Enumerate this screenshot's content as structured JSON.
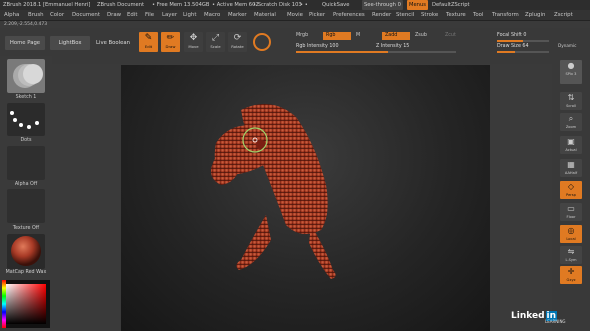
{
  "titlebar": {
    "app": "ZBrush 2018.1 [Emmanuel Henri]",
    "document": "ZBrush Document",
    "free_mem": "• Free Mem 13.504GB",
    "active_mem": "• Active Mem 602",
    "scratch": "• Scratch Disk 103",
    "dots": "• •",
    "quicksave": "QuickSave",
    "see_through": "See-through  0",
    "menus": "Menus",
    "script": "DefaultZScript"
  },
  "menu": [
    "Alpha",
    "Brush",
    "Color",
    "Document",
    "Draw",
    "Edit",
    "File",
    "Layer",
    "Light",
    "Macro",
    "Marker",
    "Material",
    "Movie",
    "Picker",
    "Preferences",
    "Render",
    "Stencil",
    "Stroke",
    "Texture",
    "Tool",
    "Transform",
    "Zplugin",
    "Zscript"
  ],
  "subrow": "2.209,-2.554,0.473",
  "toolbar": {
    "home": "Home Page",
    "lightbox": "LightBox",
    "live_boolean": "Live Boolean",
    "edit": "Edit",
    "draw": "Draw",
    "move": "Move",
    "scale": "Scale",
    "rotate": "Rotate",
    "mrgb": "Mrgb",
    "rgb": "Rgb",
    "m": "M",
    "zadd": "Zadd",
    "zsub": "Zsub",
    "zcut": "Zcut",
    "rgb_intensity": "Rgb Intensity 100",
    "z_intensity": "Z Intensity 15",
    "focal_shift": "Focal Shift 0",
    "draw_size": "Draw Size 64",
    "dynamic": "Dynamic"
  },
  "left": {
    "sketch": "Sketch 1",
    "dots": "Dots",
    "alpha": "Alpha Off",
    "texture": "Texture Off",
    "matcap": "MatCap Red Wax"
  },
  "right": {
    "spix": "SPix 3",
    "buttons": [
      "Scroll",
      "Zoom",
      "Actual",
      "AAHalf",
      "Persp",
      "Floor",
      "Local",
      "L.Sym",
      "Gxyz"
    ]
  },
  "watermark": {
    "brand": "Linked",
    "in": "in",
    "sub": "LEARNING"
  },
  "colors": {
    "accent": "#e07a22",
    "wax": "#b5402a"
  }
}
